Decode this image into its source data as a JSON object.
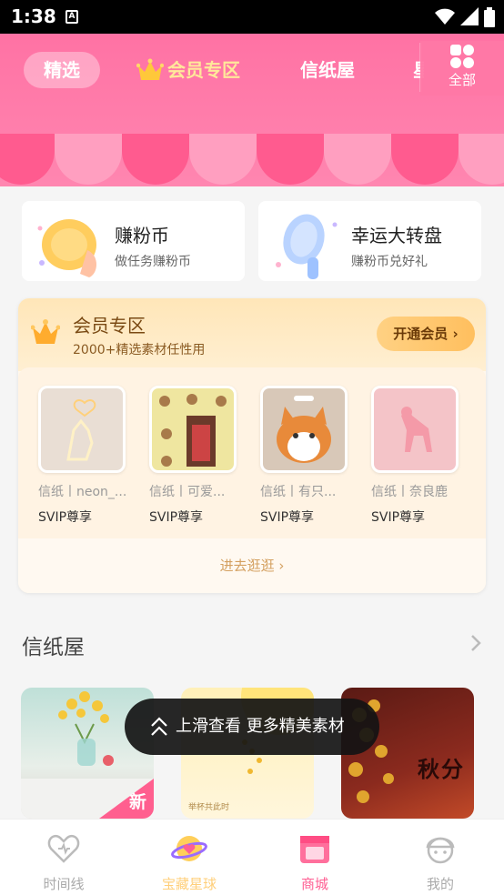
{
  "status_bar": {
    "time": "1:38",
    "notif_letter": "A"
  },
  "tabs": [
    {
      "label": "精选",
      "selected": true
    },
    {
      "label": "会员专区",
      "icon": "crown-icon"
    },
    {
      "label": "信纸屋"
    },
    {
      "label": "星"
    }
  ],
  "all_button": {
    "label": "全部",
    "icon": "grid-icon"
  },
  "quick_cards": [
    {
      "title": "赚粉币",
      "subtitle": "做任务赚粉币",
      "icon": "coin-icon"
    },
    {
      "title": "幸运大转盘",
      "subtitle": "赚粉币兑好礼",
      "icon": "fan-wheel-icon"
    }
  ],
  "vip": {
    "title": "会员专区",
    "subtitle": "2000+精选素材任性用",
    "open_label": "开通会员",
    "items": [
      {
        "title": "信纸丨neon_...",
        "tag": "SVIP尊享"
      },
      {
        "title": "信纸丨可爱...",
        "tag": "SVIP尊享"
      },
      {
        "title": "信纸丨有只...",
        "tag": "SVIP尊享"
      },
      {
        "title": "信纸丨奈良鹿",
        "tag": "SVIP尊享"
      }
    ],
    "more_label": "进去逛逛"
  },
  "paper_section": {
    "title": "信纸屋",
    "cards": [
      {
        "name": "flowers-vase",
        "new_label": "新"
      },
      {
        "name": "yellow-moon",
        "caption": "举杯共此时"
      },
      {
        "name": "autumn",
        "caption": "秋分"
      }
    ]
  },
  "toast": {
    "text": "上滑查看 更多精美素材"
  },
  "bottom_nav": [
    {
      "label": "时间线",
      "icon": "heart-timeline-icon",
      "active": false
    },
    {
      "label": "宝藏星球",
      "icon": "planet-icon",
      "active": false
    },
    {
      "label": "商城",
      "icon": "shop-icon",
      "active": true
    },
    {
      "label": "我的",
      "icon": "profile-icon",
      "active": false
    }
  ],
  "colors": {
    "pink": "#ff72a4",
    "active_nav": "#ff5f93",
    "gold": "#ffbf5e"
  }
}
